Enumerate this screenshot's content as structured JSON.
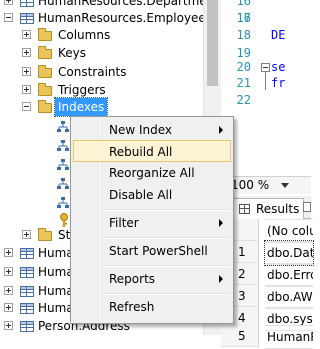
{
  "tree": {
    "items": [
      {
        "label": "HumanResources.Department",
        "type": "table",
        "expander": "plus"
      },
      {
        "label": "HumanResources.Employee",
        "type": "table",
        "expander": "minus"
      },
      {
        "label": "Columns",
        "type": "folder",
        "expander": "plus"
      },
      {
        "label": "Keys",
        "type": "folder",
        "expander": "plus"
      },
      {
        "label": "Constraints",
        "type": "folder",
        "expander": "plus"
      },
      {
        "label": "Triggers",
        "type": "folder",
        "expander": "plus"
      },
      {
        "label": "Indexes",
        "type": "folder",
        "expander": "minus",
        "selected": true
      },
      {
        "label": "",
        "type": "index"
      },
      {
        "label": "",
        "type": "index"
      },
      {
        "label": "",
        "type": "index"
      },
      {
        "label": "",
        "type": "index"
      },
      {
        "label": "",
        "type": "index"
      },
      {
        "label": "",
        "type": "key"
      },
      {
        "label": "Sta",
        "type": "folder",
        "expander": "plus"
      },
      {
        "label": "Human",
        "type": "table",
        "expander": "plus"
      },
      {
        "label": "Human",
        "type": "table",
        "expander": "plus"
      },
      {
        "label": "Human",
        "type": "table",
        "expander": "plus"
      },
      {
        "label": "Human",
        "type": "table",
        "expander": "plus"
      },
      {
        "label": "Person.Address",
        "type": "table",
        "expander": "plus"
      }
    ]
  },
  "editor": {
    "line_numbers": [
      "16",
      "17",
      "18",
      "19",
      "20",
      "21",
      "22"
    ],
    "code_lines": [
      "",
      "",
      "DE",
      "",
      "se",
      "fr",
      ""
    ]
  },
  "zoom": {
    "value": "100 %"
  },
  "results": {
    "tab_label": "Results",
    "header": "(No colu",
    "rows": [
      {
        "num": "1",
        "value": "dbo.Data"
      },
      {
        "num": "2",
        "value": "dbo.Error"
      },
      {
        "num": "3",
        "value": "dbo.AWI"
      },
      {
        "num": "4",
        "value": "dbo.sysd"
      },
      {
        "num": "5",
        "value": "HumanR"
      }
    ]
  },
  "context_menu": {
    "items": [
      {
        "label": "New Index",
        "submenu": true
      },
      {
        "label": "Rebuild All",
        "submenu": false,
        "highlighted": true
      },
      {
        "label": "Reorganize All",
        "submenu": false
      },
      {
        "label": "Disable All",
        "submenu": false
      },
      {
        "label": "Filter",
        "submenu": true
      },
      {
        "label": "Start PowerShell",
        "submenu": false
      },
      {
        "label": "Reports",
        "submenu": true
      },
      {
        "label": "Refresh",
        "submenu": false
      }
    ]
  }
}
